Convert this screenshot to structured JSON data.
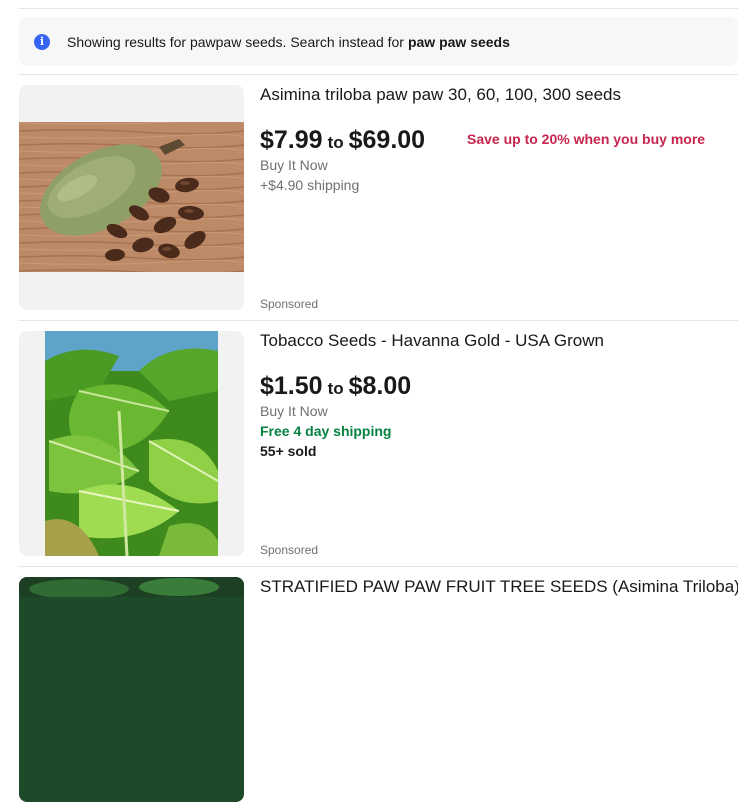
{
  "notice": {
    "icon": "info-icon",
    "message": "Showing results for pawpaw seeds. Search instead for",
    "alt_query": "paw paw seeds"
  },
  "results": [
    {
      "title": "Asimina triloba paw paw 30, 60, 100, 300 seeds",
      "price_low": "$7.99",
      "price_to": "to",
      "price_high": "$69.00",
      "buy_format": "Buy It Now",
      "shipping": "+$4.90 shipping",
      "promo": "Save up to 20% when you buy more",
      "sponsored": "Sponsored"
    },
    {
      "title": "Tobacco Seeds - Havanna Gold - USA Grown",
      "price_low": "$1.50",
      "price_to": "to",
      "price_high": "$8.00",
      "buy_format": "Buy It Now",
      "shipping": "Free 4 day shipping",
      "sold": "55+ sold",
      "sponsored": "Sponsored"
    },
    {
      "title": "STRATIFIED PAW PAW FRUIT TREE SEEDS (Asimina Triloba) IND"
    }
  ],
  "colors": {
    "accent_blue": "#3665f3",
    "promo_red": "#c7254e",
    "shipping_green": "#05823f"
  }
}
